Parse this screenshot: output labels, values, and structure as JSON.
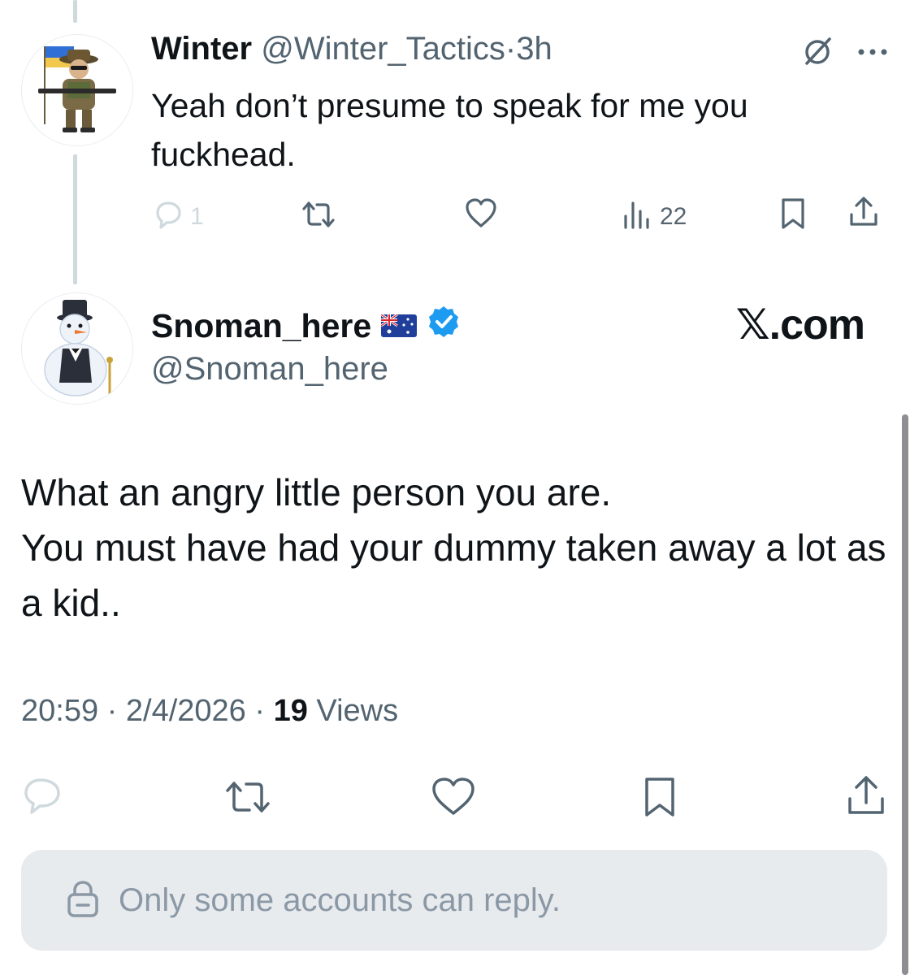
{
  "reply_tweet": {
    "author_name": "Winter",
    "handle": "@Winter_Tactics",
    "separator": "·",
    "time": "3h",
    "text": "Yeah don’t presume to speak for me you fuckhead.",
    "actions": {
      "reply_count": "1",
      "views_count": "22"
    },
    "icons": [
      "grok-icon",
      "more-icon",
      "reply-icon",
      "retweet-icon",
      "like-icon",
      "views-icon",
      "bookmark-icon",
      "share-icon"
    ]
  },
  "main_tweet": {
    "author_name": "Snoman_here",
    "flag": "🇦🇺",
    "handle": "@Snoman_here",
    "watermark": "𝕏.com",
    "text_line1": "What an angry little person you are.",
    "text_line2": "You must have had your dummy taken away a lot as a kid..",
    "time": "20:59",
    "separator": "·",
    "date": "2/4/2026",
    "views_count": "19",
    "views_label": "Views",
    "icons": [
      "reply-icon",
      "retweet-icon",
      "like-icon",
      "bookmark-icon",
      "share-icon"
    ]
  },
  "reply_restriction": {
    "text": "Only some accounts can reply.",
    "icon": "lock-icon"
  },
  "colors": {
    "text": "#0f1419",
    "muted": "#536471",
    "verified": "#1d9bf0",
    "reply_box_bg": "#e7ebee"
  }
}
